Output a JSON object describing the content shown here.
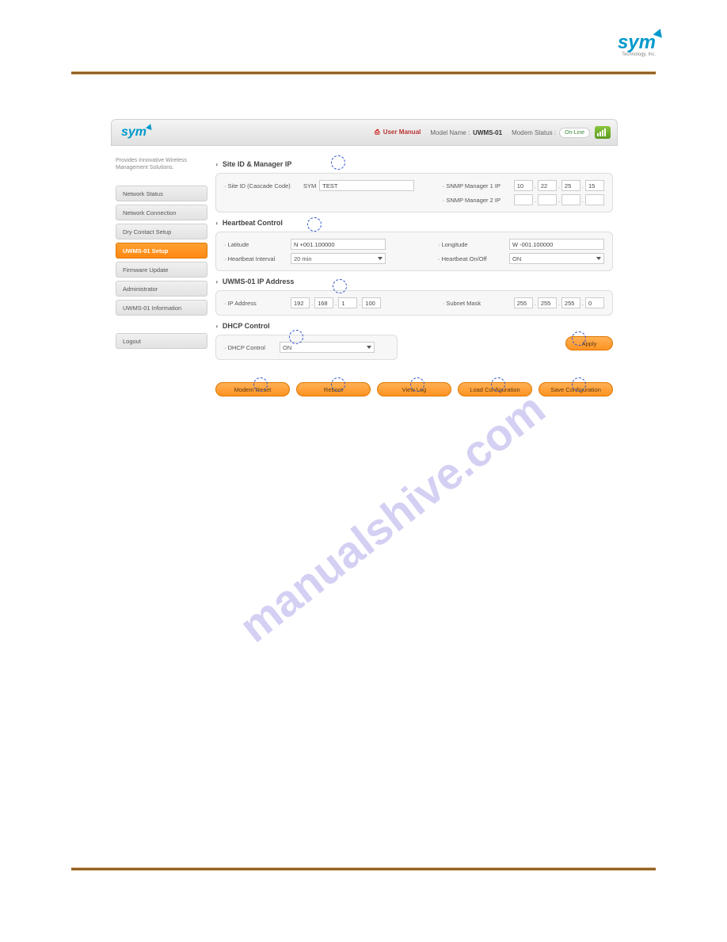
{
  "brand": {
    "name": "sym",
    "tagline": "Technology, Inc."
  },
  "header": {
    "user_manual": "User Manual",
    "model_name_label": "Model Name  :",
    "model_name": "UWMS-01",
    "modem_status_label": "Modem Status  :",
    "modem_status": "On-Line"
  },
  "sidebar": {
    "tagline": "Provides Innovative Wireless Management Solutions.",
    "items": [
      {
        "label": "Network Status",
        "active": false
      },
      {
        "label": "Network Connection",
        "active": false
      },
      {
        "label": "Dry Contact Setup",
        "active": false
      },
      {
        "label": "UWMS-01 Setup",
        "active": true
      },
      {
        "label": "Firmware Update",
        "active": false
      },
      {
        "label": "Administrator",
        "active": false
      },
      {
        "label": "UWMS-01 Information",
        "active": false
      }
    ],
    "logout": "Logout"
  },
  "sections": {
    "site": {
      "title": "Site ID & Manager IP",
      "site_id_label": "Site ID (Cascade Code)",
      "site_id_prefix": "SYM",
      "site_id_value": "TEST",
      "snmp1_label": "SNMP Manager 1 IP",
      "snmp1": [
        "10",
        "22",
        "25",
        "15"
      ],
      "snmp2_label": "SNMP Manager 2 IP",
      "snmp2": [
        "",
        "",
        "",
        ""
      ]
    },
    "heartbeat": {
      "title": "Heartbeat Control",
      "lat_label": "Latitude",
      "lat_value": "N +001.100000",
      "lon_label": "Longitude",
      "lon_value": "W -001.100000",
      "interval_label": "Heartbeat Interval",
      "interval_value": "20 min",
      "onoff_label": "Heartbeat On/Off",
      "onoff_value": "ON"
    },
    "ip": {
      "title": "UWMS-01 IP Address",
      "ip_label": "IP Address",
      "ip": [
        "192",
        "168",
        "1",
        "100"
      ],
      "mask_label": "Subnet Mask",
      "mask": [
        "255",
        "255",
        "255",
        "0"
      ]
    },
    "dhcp": {
      "title": "DHCP Control",
      "label": "DHCP Control",
      "value": "ON"
    }
  },
  "buttons": {
    "apply": "Apply",
    "modem_reset": "Modem Reset",
    "reboot": "Reboot",
    "view_log": "View Log",
    "load_config": "Load Configuration",
    "save_config": "Save Configuration"
  },
  "watermark": "manualshive.com"
}
